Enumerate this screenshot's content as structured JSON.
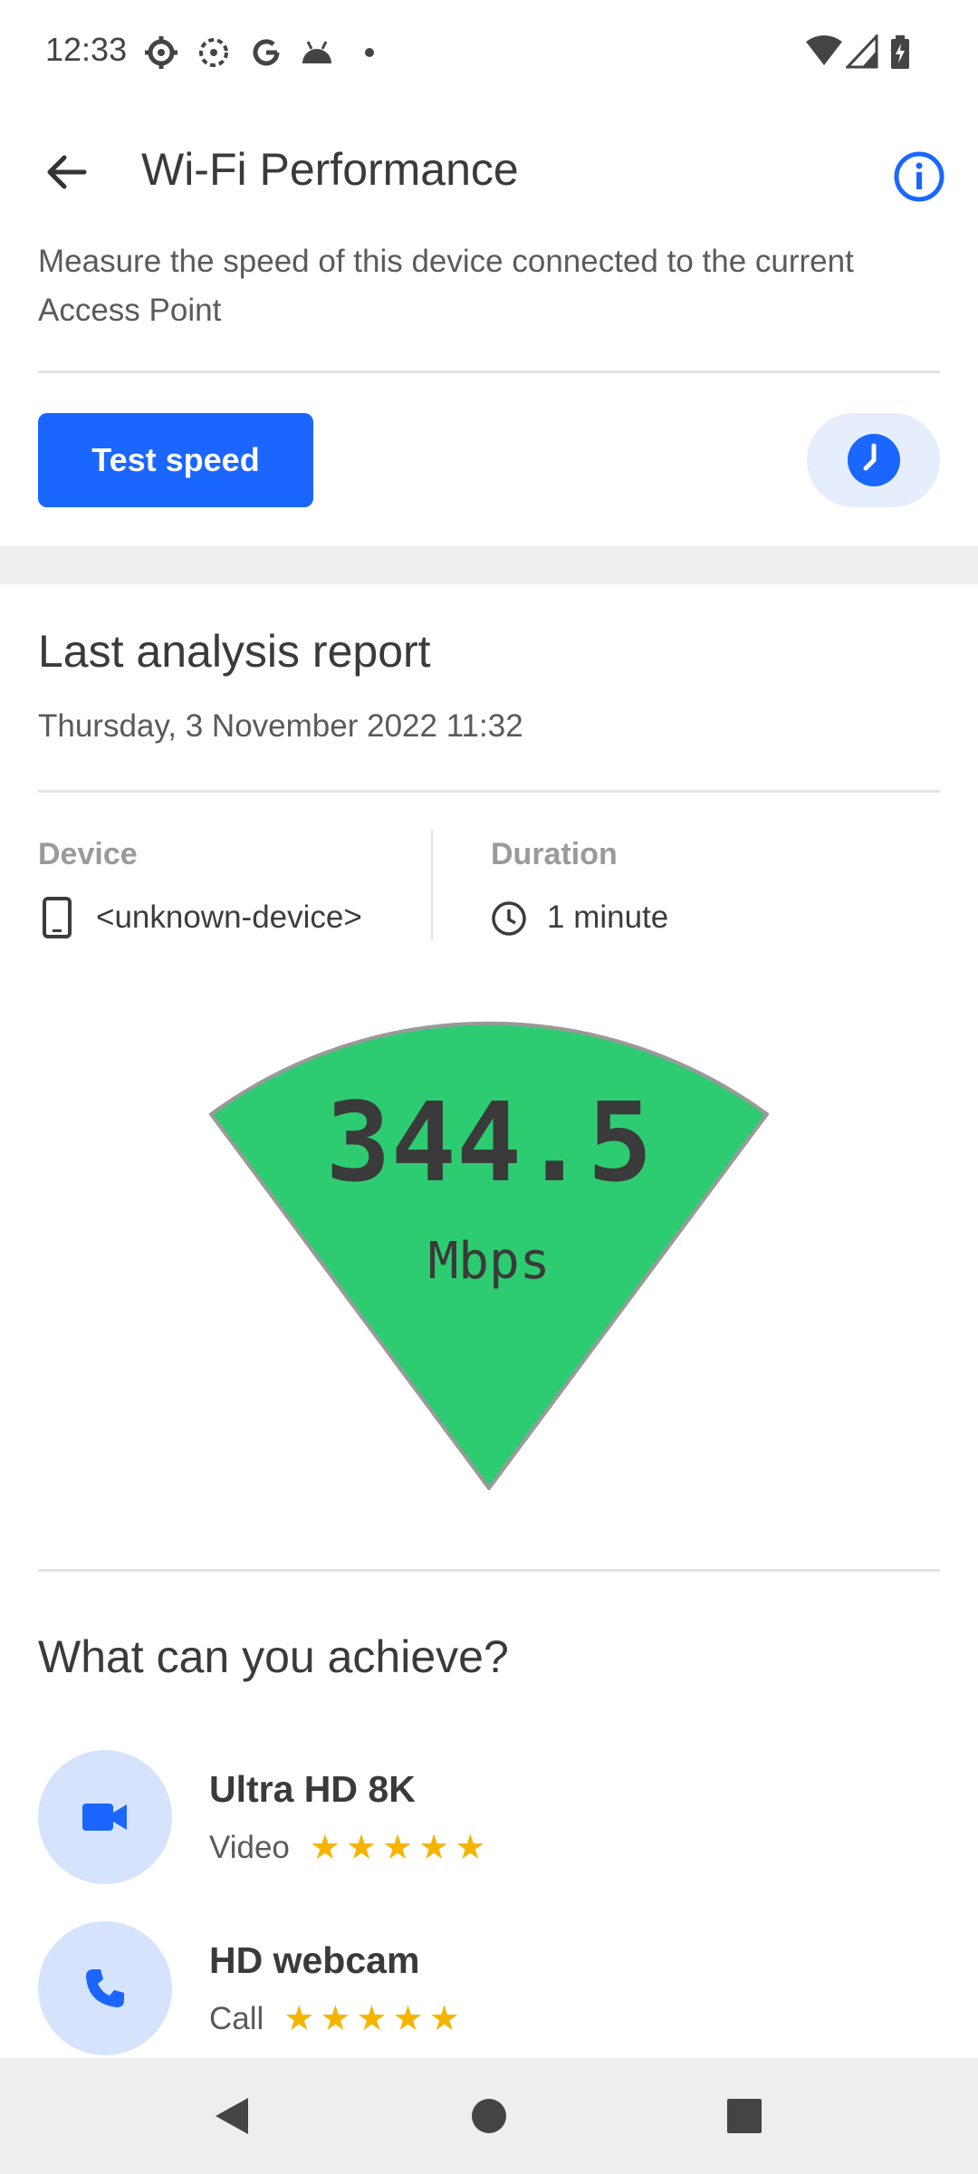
{
  "status_bar": {
    "time": "12:33",
    "left_icons": [
      "settings-icon",
      "sync-icon",
      "google-icon",
      "android-icon",
      "dot-icon"
    ],
    "right_icons": [
      "wifi-icon",
      "signal-icon",
      "battery-charging-icon"
    ]
  },
  "app_bar": {
    "title": "Wi-Fi Performance",
    "back_icon": "arrow-back-icon",
    "info_icon": "info-icon"
  },
  "intro": {
    "description": "Measure the speed of this device connected to the current Access Point",
    "test_button_label": "Test speed",
    "schedule_icon": "clock-icon"
  },
  "report": {
    "title": "Last analysis report",
    "date": "Thursday, 3 November 2022 11:32",
    "device_label": "Device",
    "device_value": "<unknown-device>",
    "duration_label": "Duration",
    "duration_value": "1 minute"
  },
  "gauge": {
    "value": "344.5",
    "unit": "Mbps",
    "color": "#2ecc71"
  },
  "achieve": {
    "title": "What can you achieve?",
    "items": [
      {
        "icon": "videocam-icon",
        "title": "Ultra HD 8K",
        "subtitle": "Video",
        "rating": 5
      },
      {
        "icon": "phone-icon",
        "title": "HD webcam",
        "subtitle": "Call",
        "rating": 5
      }
    ]
  },
  "colors": {
    "accent": "#1a66ff",
    "star": "#f5b400",
    "icon_bg": "#d6e3fd"
  }
}
